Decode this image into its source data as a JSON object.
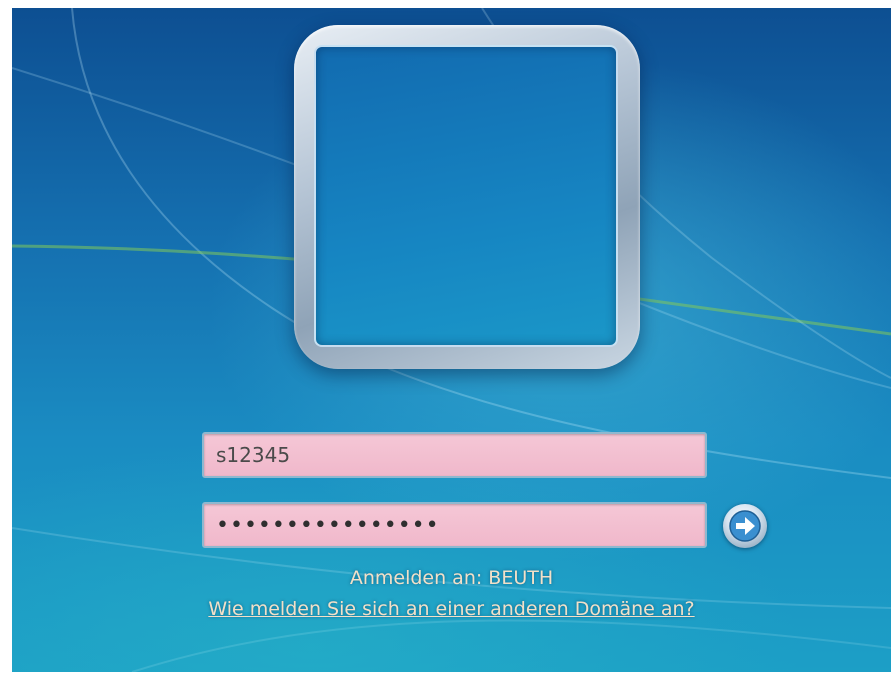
{
  "login": {
    "username_value": "s12345",
    "password_value": "••••••••••••••••",
    "logon_domain_text": "Anmelden an: BEUTH",
    "other_domain_link": "Wie melden Sie sich an einer anderen Domäne an?"
  },
  "icons": {
    "submit": "arrow-right-icon"
  },
  "colors": {
    "field_background": "#f0b8cb",
    "field_border": "#8fb8cf",
    "text_light": "#f2e0c8",
    "wallpaper_top": "#0d4f92",
    "wallpaper_bottom": "#1c9fc6",
    "submit_arrow": "#3a8fd0"
  }
}
